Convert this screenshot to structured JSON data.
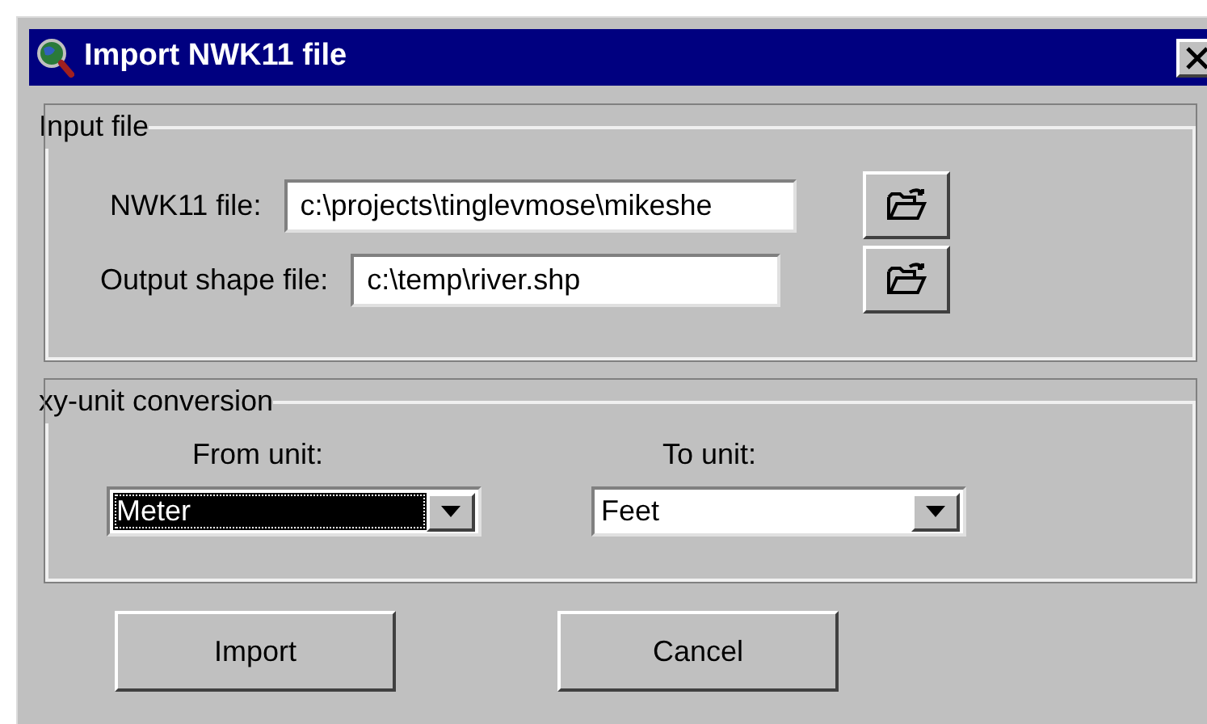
{
  "window": {
    "title": "Import NWK11 file"
  },
  "input_group": {
    "title": "Input file",
    "fields": [
      {
        "label": "NWK11 file:",
        "value": "c:\\projects\\tinglevmose\\mikeshe"
      },
      {
        "label": "Output shape file:",
        "value": "c:\\temp\\river.shp"
      }
    ]
  },
  "unit_group": {
    "title": "xy-unit conversion",
    "dropdowns": [
      {
        "label": "From unit:",
        "value": "Meter",
        "focused": true
      },
      {
        "label": "To unit:",
        "value": "Feet",
        "focused": false
      }
    ]
  },
  "buttons": [
    "Import",
    "Cancel"
  ]
}
